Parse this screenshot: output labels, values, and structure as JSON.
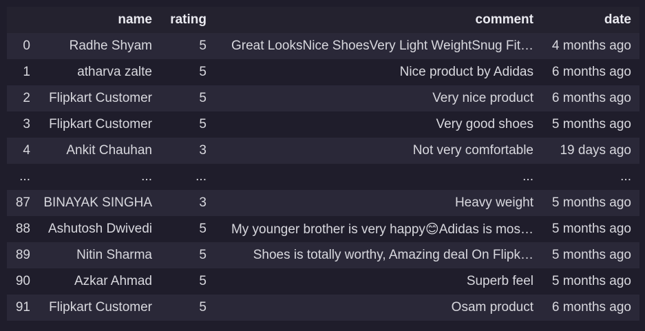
{
  "table": {
    "columns": [
      "",
      "name",
      "rating",
      "comment",
      "date"
    ],
    "rows": [
      [
        "0",
        "Radhe Shyam",
        "5",
        "Great LooksNice ShoesVery Light WeightSnug Fit…",
        "4 months ago"
      ],
      [
        "1",
        "atharva zalte",
        "5",
        "Nice product by Adidas",
        "6 months ago"
      ],
      [
        "2",
        "Flipkart Customer",
        "5",
        "Very nice product",
        "6 months ago"
      ],
      [
        "3",
        "Flipkart Customer",
        "5",
        "Very good shoes",
        "5 months ago"
      ],
      [
        "4",
        "Ankit Chauhan",
        "3",
        "Not very comfortable",
        "19 days ago"
      ],
      [
        "...",
        "...",
        "...",
        "...",
        "..."
      ],
      [
        "87",
        "BINAYAK SINGHA",
        "3",
        "Heavy weight",
        "5 months ago"
      ],
      [
        "88",
        "Ashutosh Dwivedi",
        "5",
        "My younger brother is very happy😊Adidas is mos…",
        "5 months ago"
      ],
      [
        "89",
        "Nitin Sharma",
        "5",
        "Shoes is totally worthy, Amazing deal On Flipk…",
        "5 months ago"
      ],
      [
        "90",
        "Azkar Ahmad",
        "5",
        "Superb feel",
        "5 months ago"
      ],
      [
        "91",
        "Flipkart Customer",
        "5",
        "Osam product",
        "6 months ago"
      ]
    ]
  }
}
